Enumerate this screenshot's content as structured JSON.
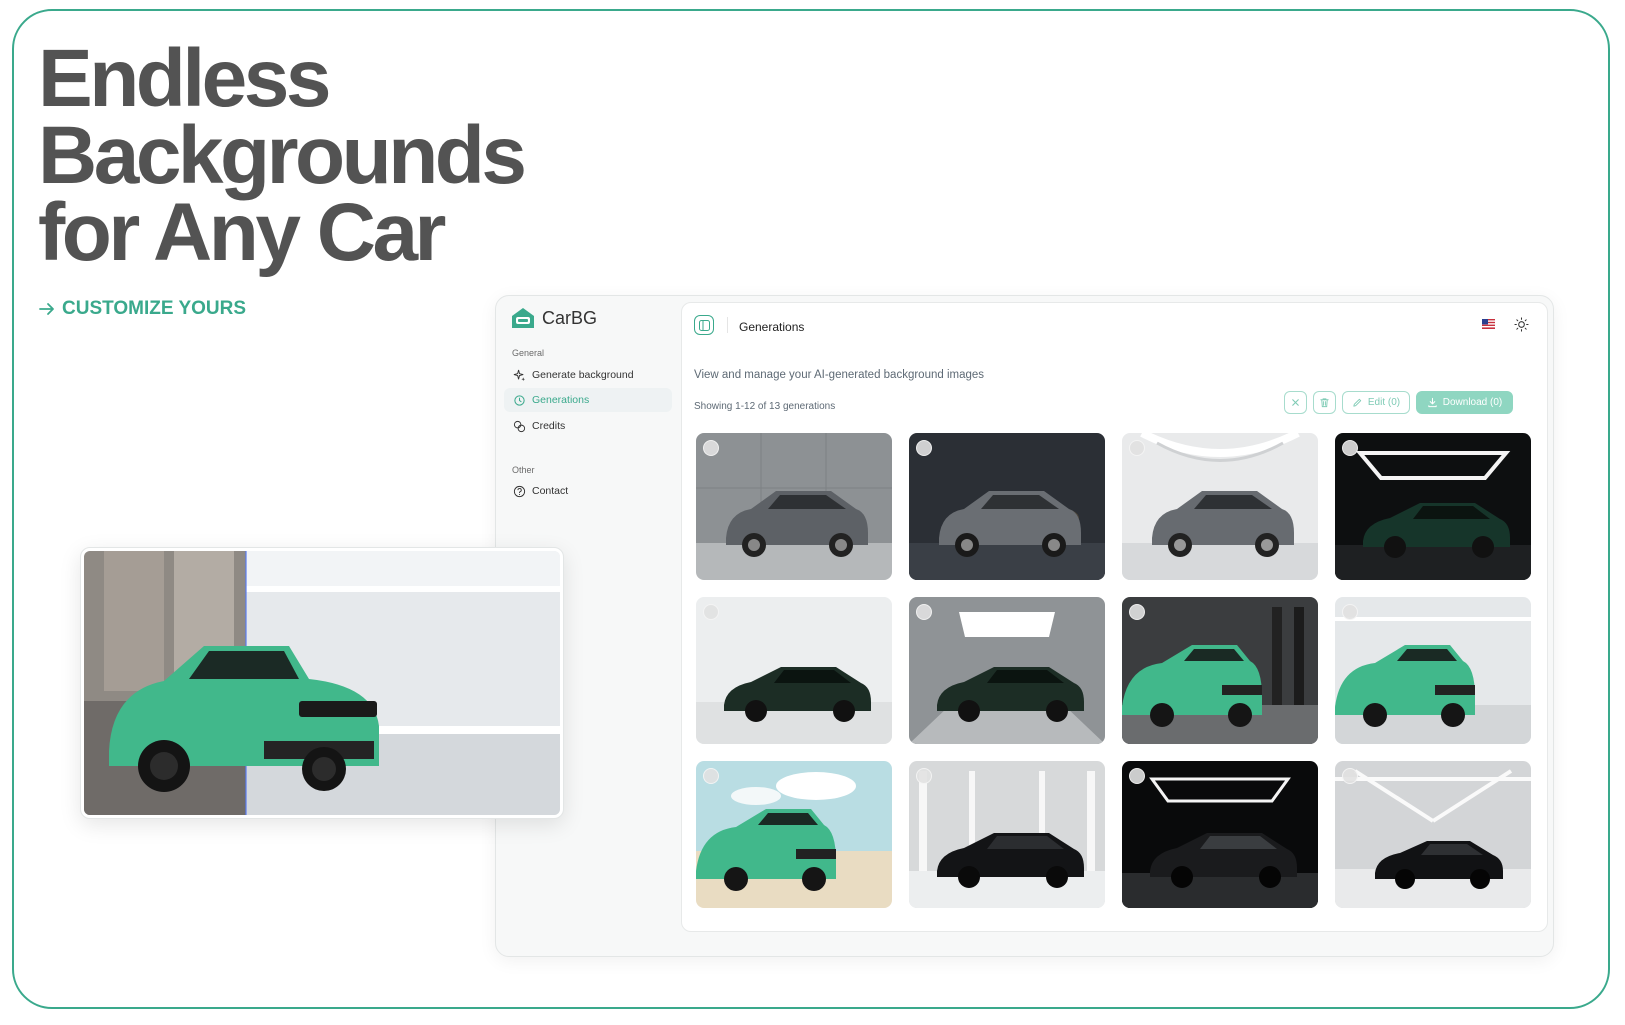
{
  "hero": {
    "title_lines": [
      "Endless",
      "Backgrounds",
      "for Any Car"
    ],
    "cta_label": "CUSTOMIZE YOURS"
  },
  "app": {
    "brand": "CarBG",
    "sidebar": {
      "groups": [
        {
          "label": "General",
          "items": [
            {
              "label": "Generate background",
              "icon": "sparkles-icon"
            },
            {
              "label": "Generations",
              "icon": "history-icon",
              "active": true
            },
            {
              "label": "Credits",
              "icon": "coins-icon"
            }
          ]
        },
        {
          "label": "Other",
          "items": [
            {
              "label": "Contact",
              "icon": "help-circle-icon"
            }
          ]
        }
      ]
    },
    "header": {
      "title": "Generations",
      "language": "us-flag-icon",
      "theme": "sun-icon"
    },
    "subtitle": "View and manage your AI-generated background images",
    "count_text": "Showing 1-12 of 13 generations",
    "actions": {
      "clear": "x-icon",
      "delete": "trash-icon",
      "edit_label": "Edit (0)",
      "download_label": "Download (0)"
    },
    "generations": [
      {
        "car": "grey SUV",
        "background": "concrete wall"
      },
      {
        "car": "grey SUV",
        "background": "dark studio"
      },
      {
        "car": "grey SUV",
        "background": "white tunnel"
      },
      {
        "car": "dark green sedan",
        "background": "dark studio with light frame"
      },
      {
        "car": "dark green sedan",
        "background": "white studio"
      },
      {
        "car": "dark green sedan",
        "background": "padded tunnel"
      },
      {
        "car": "green SUV",
        "background": "dark hall with pillars"
      },
      {
        "car": "green SUV",
        "background": "white studio"
      },
      {
        "car": "green SUV",
        "background": "beach"
      },
      {
        "car": "black sedan",
        "background": "white warehouse"
      },
      {
        "car": "black sedan",
        "background": "dark studio with light frame"
      },
      {
        "car": "black sedan",
        "background": "white hall"
      }
    ]
  },
  "colors": {
    "accent": "#3aa98c",
    "title": "#535353"
  }
}
